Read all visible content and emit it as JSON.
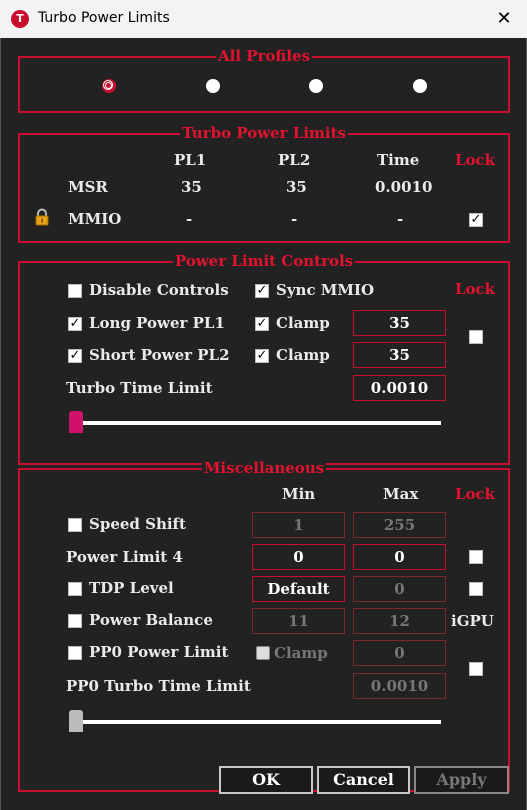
{
  "window": {
    "title": "Turbo Power Limits",
    "close_glyph": "✕",
    "app_icon": "T"
  },
  "colors": {
    "accent": "#e3122f",
    "background": "#222222",
    "text": "#eaeaea"
  },
  "all_profiles": {
    "title": "All Profiles",
    "selected_index": 0,
    "profile_count": 4
  },
  "turbo_power_limits": {
    "title": "Turbo Power Limits",
    "headers": {
      "pl1": "PL1",
      "pl2": "PL2",
      "time": "Time",
      "lock": "Lock"
    },
    "msr": {
      "label": "MSR",
      "pl1": "35",
      "pl2": "35",
      "time": "0.0010"
    },
    "mmio": {
      "label": "MMIO",
      "pl1": "-",
      "pl2": "-",
      "time": "-",
      "locked": true,
      "icon": "lock-icon"
    }
  },
  "power_limit_controls": {
    "title": "Power Limit Controls",
    "lock_label": "Lock",
    "disable_controls": {
      "label": "Disable Controls",
      "checked": false
    },
    "sync_mmio": {
      "label": "Sync MMIO",
      "checked": true
    },
    "long_power": {
      "label": "Long Power PL1",
      "checked": true,
      "clamp_label": "Clamp",
      "clamp": true,
      "value": "35"
    },
    "short_power": {
      "label": "Short Power PL2",
      "checked": true,
      "clamp_label": "Clamp",
      "clamp": true,
      "value": "35"
    },
    "turbo_time_limit": {
      "label": "Turbo Time Limit",
      "value": "0.0010",
      "slider_position": 0
    },
    "locked": false
  },
  "miscellaneous": {
    "title": "Miscellaneous",
    "headers": {
      "min": "Min",
      "max": "Max",
      "lock": "Lock"
    },
    "speed_shift": {
      "label": "Speed Shift",
      "checked": false,
      "min": "1",
      "max": "255"
    },
    "power_limit_4": {
      "label": "Power Limit 4",
      "min": "0",
      "max": "0",
      "locked": false
    },
    "tdp_level": {
      "label": "TDP Level",
      "checked": false,
      "min": "Default",
      "max": "0",
      "locked": false
    },
    "power_balance": {
      "label": "Power Balance",
      "checked": false,
      "min": "11",
      "max": "12",
      "side_label": "iGPU"
    },
    "pp0_power_limit": {
      "label": "PP0 Power Limit",
      "checked": false,
      "clamp_label": "Clamp",
      "clamp": false,
      "value": "0",
      "locked": false
    },
    "pp0_turbo_time_limit": {
      "label": "PP0 Turbo Time Limit",
      "value": "0.0010",
      "slider_position": 0
    }
  },
  "buttons": {
    "ok": "OK",
    "cancel": "Cancel",
    "apply": "Apply"
  }
}
